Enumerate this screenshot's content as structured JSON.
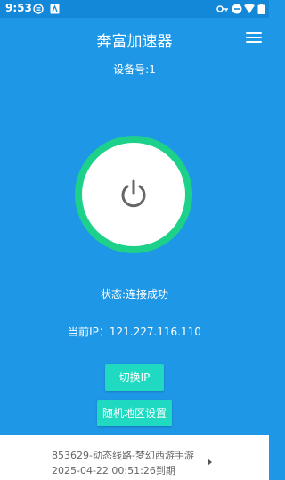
{
  "statusbar": {
    "time": "9:53"
  },
  "app": {
    "title": "奔富加速器"
  },
  "device": {
    "label": "设备号:1"
  },
  "connection": {
    "status": "状态:连接成功",
    "ip": "当前IP：121.227.116.110"
  },
  "buttons": {
    "switch_ip": "切换IP",
    "random_region": "随机地区设置"
  },
  "footer": {
    "line": "853629-动态线路-梦幻西游手游",
    "expiry": "2025-04-22 00:51:26到期"
  },
  "colors": {
    "background": "#1E97E6",
    "ring": "#1DD18A",
    "button": "#1FD9C0"
  }
}
